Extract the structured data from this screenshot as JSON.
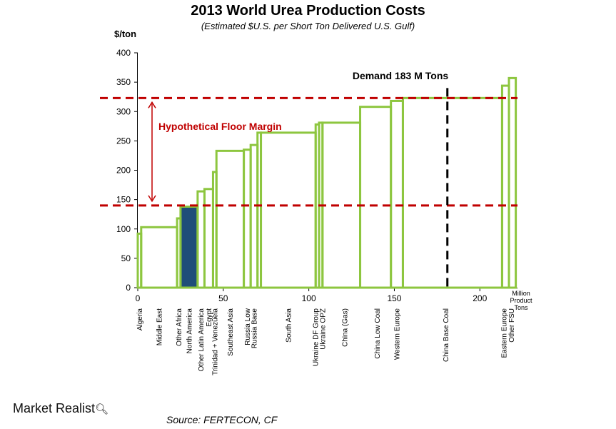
{
  "chart_data": {
    "type": "area",
    "title": "2013 World Urea Production Costs",
    "subtitle": "(Estimated $U.S. per Short Ton Delivered U.S. Gulf)",
    "ylabel": "$/ton",
    "xlabel": "Million Product Tons",
    "xlim": [
      0,
      222
    ],
    "ylim": [
      0,
      400
    ],
    "xticks": [
      0,
      50,
      100,
      150,
      200
    ],
    "yticks": [
      0,
      50,
      100,
      150,
      200,
      250,
      300,
      350,
      400
    ],
    "grid": false,
    "colors": {
      "step": "#8dc63f",
      "highlight_fill": "#1f4e79",
      "threshold": "#c00000",
      "demand": "#000000"
    },
    "segments": [
      {
        "label": "Algeria",
        "x0": 0,
        "x1": 2,
        "cost": 92
      },
      {
        "label": "Middle East",
        "x0": 2,
        "x1": 23,
        "cost": 103
      },
      {
        "label": "Other Africa",
        "x0": 23,
        "x1": 25,
        "cost": 118
      },
      {
        "label": "North America",
        "x0": 25,
        "x1": 35,
        "cost": 138,
        "highlight": true
      },
      {
        "label": "Other Latin America",
        "x0": 35,
        "x1": 39,
        "cost": 164
      },
      {
        "label": "Egypt",
        "x0": 39,
        "x1": 44,
        "cost": 168
      },
      {
        "label": "Trinidad + Venezuela",
        "x0": 44,
        "x1": 46,
        "cost": 197
      },
      {
        "label": "Southeast Asia",
        "x0": 46,
        "x1": 62,
        "cost": 233
      },
      {
        "label": "Russia Low",
        "x0": 62,
        "x1": 66,
        "cost": 235
      },
      {
        "label": "Russia Base",
        "x0": 66,
        "x1": 70,
        "cost": 243
      },
      {
        "label": "",
        "x0": 70,
        "x1": 72,
        "cost": 264
      },
      {
        "label": "South Asia",
        "x0": 72,
        "x1": 104,
        "cost": 264
      },
      {
        "label": "Ukraine DF Group",
        "x0": 104,
        "x1": 106,
        "cost": 278
      },
      {
        "label": "Ukraine OPZ",
        "x0": 106,
        "x1": 108,
        "cost": 281
      },
      {
        "label": "China (Gas)",
        "x0": 108,
        "x1": 130,
        "cost": 281
      },
      {
        "label": "China Low Coal",
        "x0": 130,
        "x1": 148,
        "cost": 308
      },
      {
        "label": "Western Europe",
        "x0": 148,
        "x1": 155,
        "cost": 318
      },
      {
        "label": "China Base Coal",
        "x0": 155,
        "x1": 213,
        "cost": 323
      },
      {
        "label": "Eastern Europe",
        "x0": 213,
        "x1": 217,
        "cost": 344
      },
      {
        "label": "Other FSU",
        "x0": 217,
        "x1": 221,
        "cost": 357
      }
    ],
    "category_labels": [
      {
        "text": "Algeria",
        "x": 1
      },
      {
        "text": "Middle East",
        "x": 12.5
      },
      {
        "text": "Other Africa",
        "x": 24
      },
      {
        "text": "North America",
        "x": 30
      },
      {
        "text": "Other Latin America",
        "x": 37
      },
      {
        "text": "Egypt",
        "x": 41.5
      },
      {
        "text": "Trinidad + Venezuela",
        "x": 45
      },
      {
        "text": "Southeast Asia",
        "x": 54
      },
      {
        "text": "Russia Low",
        "x": 64
      },
      {
        "text": "Russia Base",
        "x": 68
      },
      {
        "text": "South Asia",
        "x": 88
      },
      {
        "text": "Ukraine DF Group",
        "x": 104
      },
      {
        "text": "Ukraine OPZ",
        "x": 108
      },
      {
        "text": "China (Gas)",
        "x": 121
      },
      {
        "text": "China Low Coal",
        "x": 140
      },
      {
        "text": "Western Europe",
        "x": 151.5
      },
      {
        "text": "China Base Coal",
        "x": 180
      },
      {
        "text": "Eastern Europe",
        "x": 214
      },
      {
        "text": "Other FSU",
        "x": 218.5
      }
    ],
    "x_unit_label": [
      "Million",
      "Product",
      "Tons"
    ],
    "lines": {
      "ceiling": 323,
      "floor": 140,
      "demand_x": 181
    },
    "annotations": {
      "demand": "Demand 183 M Tons",
      "margin": "Hypothetical Floor Margin"
    }
  },
  "footer": {
    "source": "Source: FERTECON, CF",
    "brand": "Market Realist",
    "brand_icon": "magnifier-icon"
  }
}
